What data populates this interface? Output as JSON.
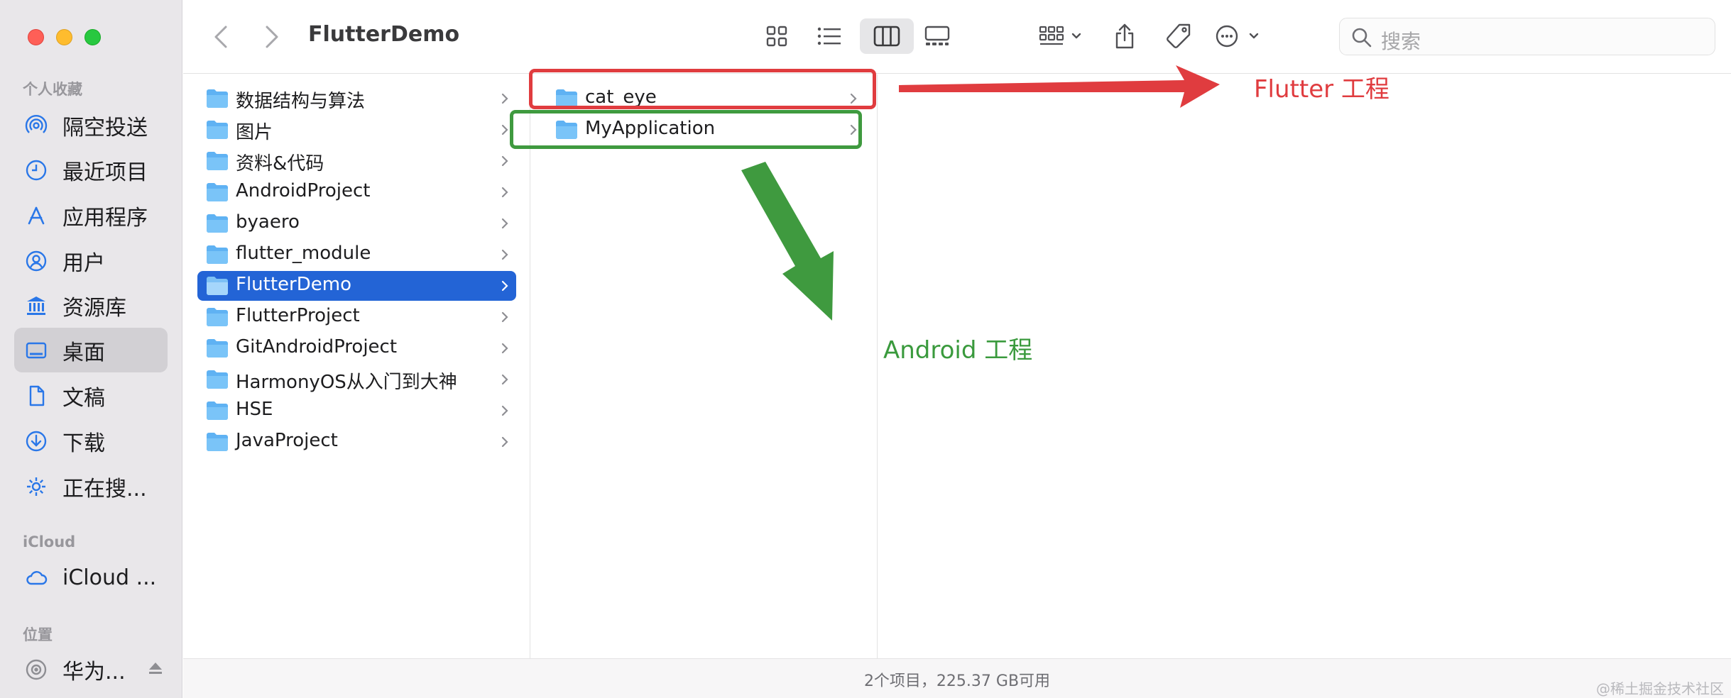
{
  "window": {
    "title": "FlutterDemo"
  },
  "sidebar": {
    "favorites_title": "个人收藏",
    "favorites": [
      {
        "label": "隔空投送",
        "icon": "airdrop-icon"
      },
      {
        "label": "最近项目",
        "icon": "clock-icon"
      },
      {
        "label": "应用程序",
        "icon": "applications-icon"
      },
      {
        "label": "用户",
        "icon": "user-icon"
      },
      {
        "label": "资源库",
        "icon": "library-icon"
      },
      {
        "label": "桌面",
        "icon": "desktop-icon",
        "selected": true
      },
      {
        "label": "文稿",
        "icon": "document-icon"
      },
      {
        "label": "下载",
        "icon": "download-icon"
      },
      {
        "label": "正在搜...",
        "icon": "gear-icon"
      }
    ],
    "icloud_title": "iCloud",
    "icloud": [
      {
        "label": "iCloud ...",
        "icon": "cloud-icon"
      }
    ],
    "locations_title": "位置",
    "locations": [
      {
        "label": "华为...",
        "icon": "disk-icon"
      }
    ]
  },
  "toolbar": {
    "back": "chevron-left-icon",
    "forward": "chevron-right-icon",
    "view_modes": [
      "icon-view-icon",
      "list-view-icon",
      "column-view-icon",
      "gallery-view-icon"
    ],
    "active_view": "column-view-icon",
    "search_placeholder": "搜索"
  },
  "columns": {
    "col1": [
      {
        "label": "数据结构与算法"
      },
      {
        "label": "图片"
      },
      {
        "label": "资料&代码"
      },
      {
        "label": "AndroidProject"
      },
      {
        "label": "byaero"
      },
      {
        "label": "flutter_module"
      },
      {
        "label": "FlutterDemo",
        "selected": true
      },
      {
        "label": "FlutterProject"
      },
      {
        "label": "GitAndroidProject"
      },
      {
        "label": "HarmonyOS从入门到大神"
      },
      {
        "label": "HSE"
      },
      {
        "label": "JavaProject"
      }
    ],
    "col2": [
      {
        "label": "cat_eye"
      },
      {
        "label": "MyApplication"
      }
    ]
  },
  "status": {
    "text": "2个项目，225.37 GB可用"
  },
  "annotations": {
    "flutter_label": "Flutter 工程",
    "android_label": "Android 工程",
    "red": "#e03c3f",
    "green": "#3f9a3f"
  },
  "watermark": "@稀土掘金技术社区"
}
